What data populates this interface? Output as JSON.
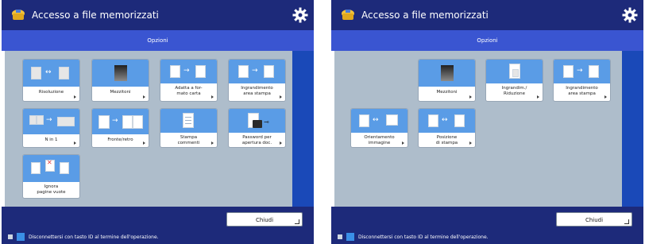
{
  "screens": [
    {
      "title": "Accesso a file memorizzati",
      "header": "Opzioni",
      "buttons": [
        {
          "lines": [
            "Risoluzione"
          ]
        },
        {
          "lines": [
            "Mezzitoni"
          ]
        },
        {
          "lines": [
            "Adatta a for-",
            "mato carta"
          ]
        },
        {
          "lines": [
            "Ingrandimento",
            "area stampa"
          ]
        },
        {
          "lines": [
            "N in 1"
          ]
        },
        {
          "lines": [
            "Fronte/retro"
          ]
        },
        {
          "lines": [
            "Stampa",
            "commenti"
          ]
        },
        {
          "lines": [
            "Password per",
            "apertura doc."
          ]
        },
        {
          "lines": [
            "Ignora",
            "pagine vuote"
          ]
        }
      ],
      "close_label": "Chiudi",
      "status_text": "Disconnettersi con tasto ID al termine dell'operazione."
    },
    {
      "title": "Accesso a file memorizzati",
      "header": "Opzioni",
      "buttons": [
        {
          "lines": [
            "Mezzitoni"
          ]
        },
        {
          "lines": [
            "Ingrandim./",
            "Riduzione"
          ]
        },
        {
          "lines": [
            "Ingrandimento",
            "area stampa"
          ]
        },
        {
          "lines": [
            "Orientamento",
            "immagine"
          ]
        },
        {
          "lines": [
            "Posizione",
            "di stampa"
          ]
        }
      ],
      "close_label": "Chiudi",
      "status_text": "Disconnettersi con tasto ID al termine dell'operazione."
    }
  ],
  "colors": {
    "titlebar": "#1d2a7a",
    "header_bar": "#3a55d1",
    "content_bg": "#aebdcb",
    "icon_area": "#5a9ce6"
  },
  "icons": [
    "file-access-app-icon",
    "settings-gear-icon",
    "info-icon"
  ]
}
